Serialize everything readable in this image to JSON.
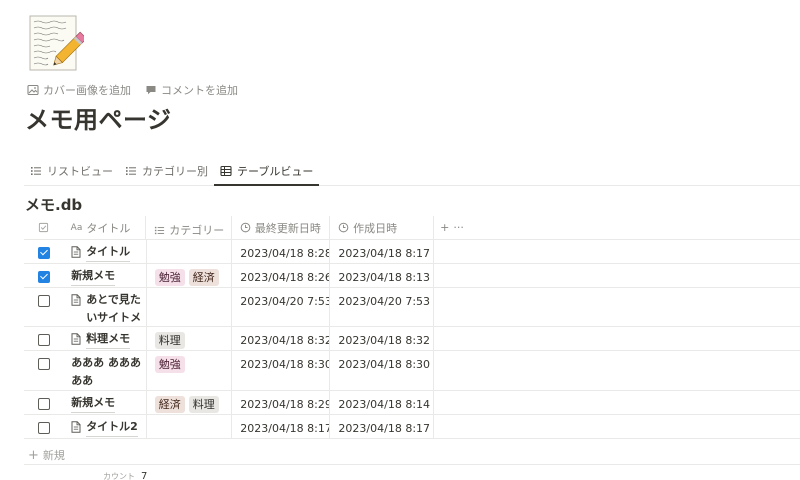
{
  "page": {
    "icon": "memo-pencil-icon",
    "actions": [
      {
        "label": "カバー画像を追加",
        "icon": "image-icon"
      },
      {
        "label": "コメントを追加",
        "icon": "comment-icon"
      }
    ],
    "title": "メモ用ページ"
  },
  "views": [
    {
      "label": "リストビュー",
      "icon": "list-icon",
      "active": false
    },
    {
      "label": "カテゴリー別",
      "icon": "list-icon",
      "active": false
    },
    {
      "label": "テーブルビュー",
      "icon": "table-icon",
      "active": true
    }
  ],
  "database": {
    "title": "メモ.db",
    "columns": {
      "title_prefix": "Aa",
      "title": "タイトル",
      "category": "カテゴリー",
      "updated": "最終更新日時",
      "created": "作成日時",
      "add": "+",
      "more": "···"
    },
    "rows": [
      {
        "checked": true,
        "has_icon": true,
        "title": "タイトル",
        "tags": [],
        "updated": "2023/04/18 8:28",
        "created": "2023/04/18 8:17"
      },
      {
        "checked": true,
        "has_icon": false,
        "title": "新規メモ",
        "tags": [
          {
            "label": "勉強",
            "kind": "study"
          },
          {
            "label": "経済",
            "kind": "econ"
          }
        ],
        "updated": "2023/04/18 8:26",
        "created": "2023/04/18 8:13"
      },
      {
        "checked": false,
        "has_icon": true,
        "title": "あとで見たいサイトメモ",
        "tags": [],
        "updated": "2023/04/20 7:53",
        "created": "2023/04/20 7:53"
      },
      {
        "checked": false,
        "has_icon": true,
        "title": "料理メモ",
        "tags": [
          {
            "label": "料理",
            "kind": "cook"
          }
        ],
        "updated": "2023/04/18 8:32",
        "created": "2023/04/18 8:32"
      },
      {
        "checked": false,
        "has_icon": false,
        "title": "あああ あああああ",
        "tags": [
          {
            "label": "勉強",
            "kind": "study"
          }
        ],
        "updated": "2023/04/18 8:30",
        "created": "2023/04/18 8:30"
      },
      {
        "checked": false,
        "has_icon": false,
        "title": "新規メモ",
        "tags": [
          {
            "label": "経済",
            "kind": "econ"
          },
          {
            "label": "料理",
            "kind": "cook"
          }
        ],
        "updated": "2023/04/18 8:29",
        "created": "2023/04/18 8:14"
      },
      {
        "checked": false,
        "has_icon": true,
        "title": "タイトル2",
        "tags": [],
        "updated": "2023/04/18 8:17",
        "created": "2023/04/18 8:17"
      }
    ],
    "new_label": "新規",
    "count_label": "カウント",
    "count_value": "7"
  },
  "colors": {
    "check_blue": "#2383e2",
    "tag_study_bg": "#f5e0e9",
    "tag_econ_bg": "#eee0da",
    "tag_cook_bg": "#e8e7e4"
  }
}
